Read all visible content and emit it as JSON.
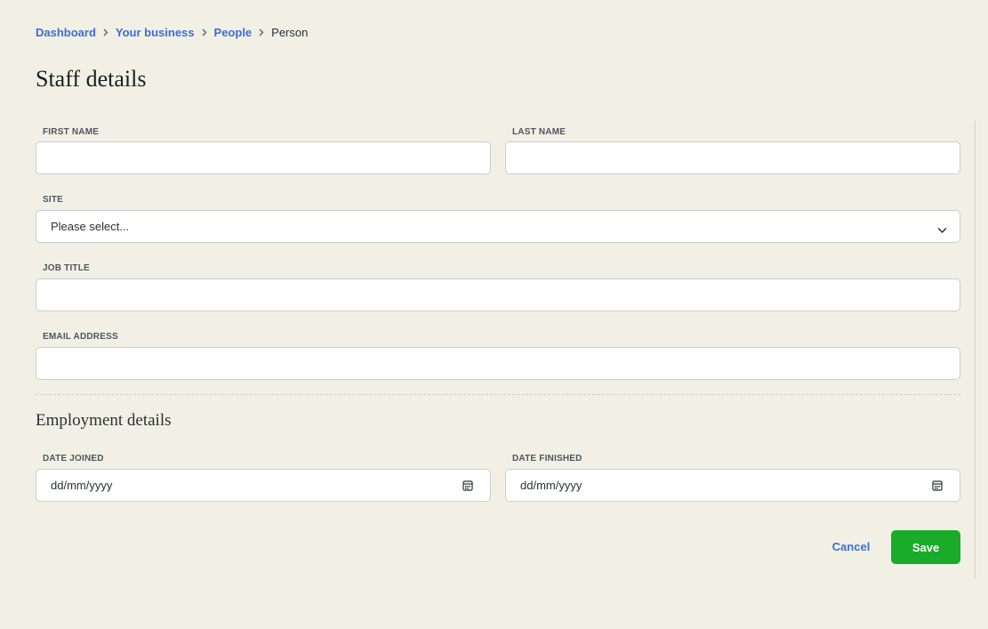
{
  "breadcrumb": {
    "items": [
      {
        "label": "Dashboard"
      },
      {
        "label": "Your business"
      },
      {
        "label": "People"
      }
    ],
    "current": "Person"
  },
  "page": {
    "title": "Staff details"
  },
  "form": {
    "first_name": {
      "label": "FIRST NAME",
      "value": ""
    },
    "last_name": {
      "label": "LAST NAME",
      "value": ""
    },
    "site": {
      "label": "SITE",
      "selected": "Please select..."
    },
    "job_title": {
      "label": "JOB TITLE",
      "value": ""
    },
    "email": {
      "label": "EMAIL ADDRESS",
      "value": ""
    }
  },
  "employment": {
    "title": "Employment details",
    "date_joined": {
      "label": "DATE JOINED",
      "placeholder": "dd/mm/yyyy"
    },
    "date_finished": {
      "label": "DATE FINISHED",
      "placeholder": "dd/mm/yyyy"
    }
  },
  "actions": {
    "cancel_label": "Cancel",
    "save_label": "Save"
  },
  "colors": {
    "background": "#f2f0e4",
    "link": "#3a6fd8",
    "save": "#1aab2a"
  },
  "icons": {
    "chevron": "chevron-right-icon",
    "select": "chevron-down-icon",
    "date": "calendar-icon"
  }
}
